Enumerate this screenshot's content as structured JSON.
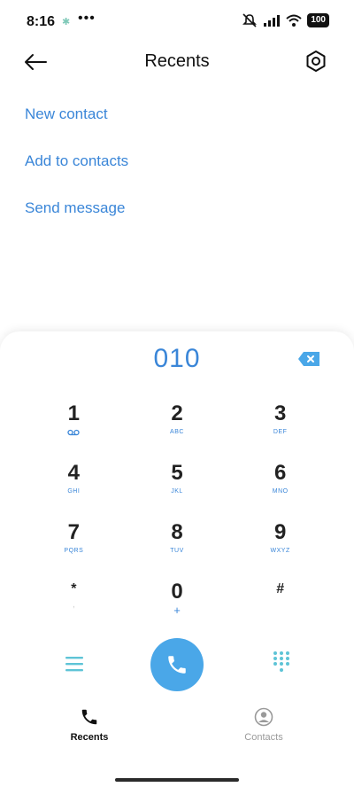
{
  "status_bar": {
    "time": "8:16",
    "notification_icon": "app-notification-icon",
    "more_indicator": "•••",
    "battery": "100",
    "icons": [
      "mute-icon",
      "signal-icon",
      "wifi-icon",
      "battery-icon"
    ]
  },
  "header": {
    "title": "Recents",
    "back_icon": "arrow-left-icon",
    "settings_icon": "hexagon-settings-icon"
  },
  "actions": [
    {
      "label": "New contact"
    },
    {
      "label": "Add to contacts"
    },
    {
      "label": "Send message"
    }
  ],
  "dialer": {
    "number": "010",
    "backspace_icon": "backspace-icon",
    "keys": [
      {
        "digit": "1",
        "letters": "voicemail"
      },
      {
        "digit": "2",
        "letters": "ABC"
      },
      {
        "digit": "3",
        "letters": "DEF"
      },
      {
        "digit": "4",
        "letters": "GHI"
      },
      {
        "digit": "5",
        "letters": "JKL"
      },
      {
        "digit": "6",
        "letters": "MNO"
      },
      {
        "digit": "7",
        "letters": "PQRS"
      },
      {
        "digit": "8",
        "letters": "TUV"
      },
      {
        "digit": "9",
        "letters": "WXYZ"
      },
      {
        "digit": "*",
        "letters": ","
      },
      {
        "digit": "0",
        "letters": "+"
      },
      {
        "digit": "#",
        "letters": ""
      }
    ],
    "call_icon": "phone-icon",
    "menu_icon": "menu-icon",
    "dialpad_icon": "dialpad-icon"
  },
  "bottom_nav": {
    "recents_label": "Recents",
    "contacts_label": "Contacts",
    "active": "Recents"
  },
  "colors": {
    "accent": "#3a86d8",
    "call_button": "#4aa7e8",
    "teal": "#5ec4d6"
  }
}
